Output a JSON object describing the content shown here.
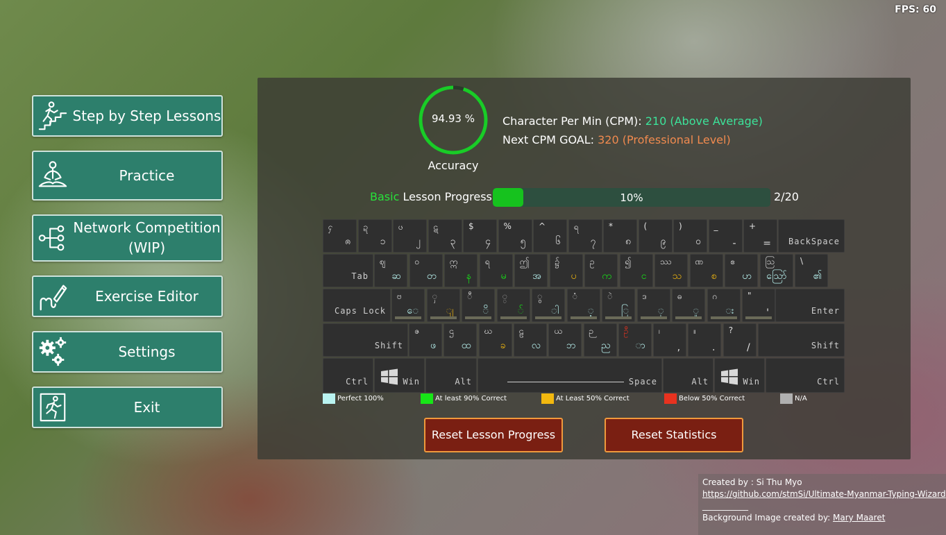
{
  "fps": "FPS: 60",
  "menu": {
    "lessons": "Step by Step Lessons",
    "practice": "Practice",
    "network_line1": "Network Competition",
    "network_line2": "(WIP)",
    "editor": "Exercise Editor",
    "settings": "Settings",
    "exit": "Exit"
  },
  "stats": {
    "accuracy_value": "94.93 %",
    "accuracy_fraction": 0.9493,
    "accuracy_label": "Accuracy",
    "cpm_label": "Character Per Min (CPM): ",
    "cpm_value": "210 (Above Average)",
    "goal_label": "Next CPM GOAL: ",
    "goal_value": "320 (Professional Level)"
  },
  "progress": {
    "level": "Basic",
    "label": " Lesson Progress:",
    "percent_text": "10%",
    "fraction": 0.1,
    "count": "2/20"
  },
  "keyboard": {
    "row1": [
      {
        "tl": "ႁ",
        "br": "ၐ"
      },
      {
        "tl": "ဍ",
        "br": "၁"
      },
      {
        "tl": "ၒ",
        "br": "၂"
      },
      {
        "tl": "ဋ",
        "br": "၃"
      },
      {
        "tl": "$",
        "br": "၄"
      },
      {
        "tl": "%",
        "br": "၅"
      },
      {
        "tl": "^",
        "br": "၆"
      },
      {
        "tl": "ရ",
        "br": "၇"
      },
      {
        "tl": "*",
        "br": "၈"
      },
      {
        "tl": "(",
        "br": "၉"
      },
      {
        "tl": ")",
        "br": "၀"
      },
      {
        "tl": "_",
        "br": "-"
      },
      {
        "tl": "+",
        "br": "="
      }
    ],
    "backspace": "BackSpace",
    "tab": "Tab",
    "row2": [
      {
        "tl": "ဈ",
        "br": "ဆ"
      },
      {
        "tl": "ဝ",
        "br": "တ"
      },
      {
        "tl": "ဣ",
        "br": "န"
      },
      {
        "tl": "ရ",
        "br": "မ"
      },
      {
        "tl": "ဤ",
        "br": "အ"
      },
      {
        "tl": "၌",
        "br": "ပ"
      },
      {
        "tl": "ဥ",
        "br": "က"
      },
      {
        "tl": "၍",
        "br": "င"
      },
      {
        "tl": "ဿ",
        "br": "သ"
      },
      {
        "tl": "ဏ",
        "br": "စ"
      },
      {
        "tl": "ဧ",
        "br": "ဟ"
      },
      {
        "tl": "ဩ",
        "br": "ဪ"
      },
      {
        "tl": "\\",
        "br": "၏"
      }
    ],
    "caps": "Caps Lock",
    "row3": [
      {
        "tl": "ဗ",
        "br": "ေ"
      },
      {
        "tl": "ှ",
        "br": "ျ"
      },
      {
        "tl": "ီ",
        "br": "ိ"
      },
      {
        "tl": "္",
        "br": "်"
      },
      {
        "tl": "ွ",
        "br": "ါ"
      },
      {
        "tl": "ံ",
        "br": "့"
      },
      {
        "tl": "ဲ",
        "br": "ြ"
      },
      {
        "tl": "ဒ",
        "br": "ု"
      },
      {
        "tl": "ဓ",
        "br": "ူ"
      },
      {
        "tl": "ဂ",
        "br": "း"
      },
      {
        "tl": "\"",
        "br": "'"
      }
    ],
    "enter": "Enter",
    "shift": "Shift",
    "row4": [
      {
        "tl": "ဇ",
        "br": "ဖ"
      },
      {
        "tl": "ဌ",
        "br": "ထ"
      },
      {
        "tl": "ဃ",
        "br": "ခ"
      },
      {
        "tl": "ဠ",
        "br": "လ"
      },
      {
        "tl": "ယ",
        "br": "ဘ"
      },
      {
        "tl": "ဉ",
        "br": "ည"
      },
      {
        "tl": "ဦ",
        "br": "ာ"
      },
      {
        "tl": "၊",
        "br": ","
      },
      {
        "tl": "။",
        "br": "."
      },
      {
        "tl": "?",
        "br": "/"
      }
    ],
    "ctrl": "Ctrl",
    "win": "Win",
    "alt": "Alt",
    "space": "Space"
  },
  "legend": {
    "perfect": "Perfect 100%",
    "ninety": "At least 90% Correct",
    "fifty": "At Least 50% Correct",
    "below": "Below 50% Correct",
    "na": "N/A"
  },
  "colors": {
    "perfect": "#b9f3f0",
    "ninety": "#17e617",
    "fifty": "#f2b80f",
    "below": "#e8321f",
    "na": "#b0b0b0",
    "button_teal": "#2d7f6c",
    "reset_red": "#7a1f12"
  },
  "buttons": {
    "reset_progress": "Reset Lesson Progress",
    "reset_stats": "Reset Statistics"
  },
  "credits": {
    "created_by": "Created by : Si Thu Myo",
    "repo_url": "https://github.com/stmSi/Ultimate-Myanmar-Typing-Wizard",
    "separator": "___________",
    "bg_label": "Background Image created by: ",
    "bg_author": "Mary Maaret"
  }
}
